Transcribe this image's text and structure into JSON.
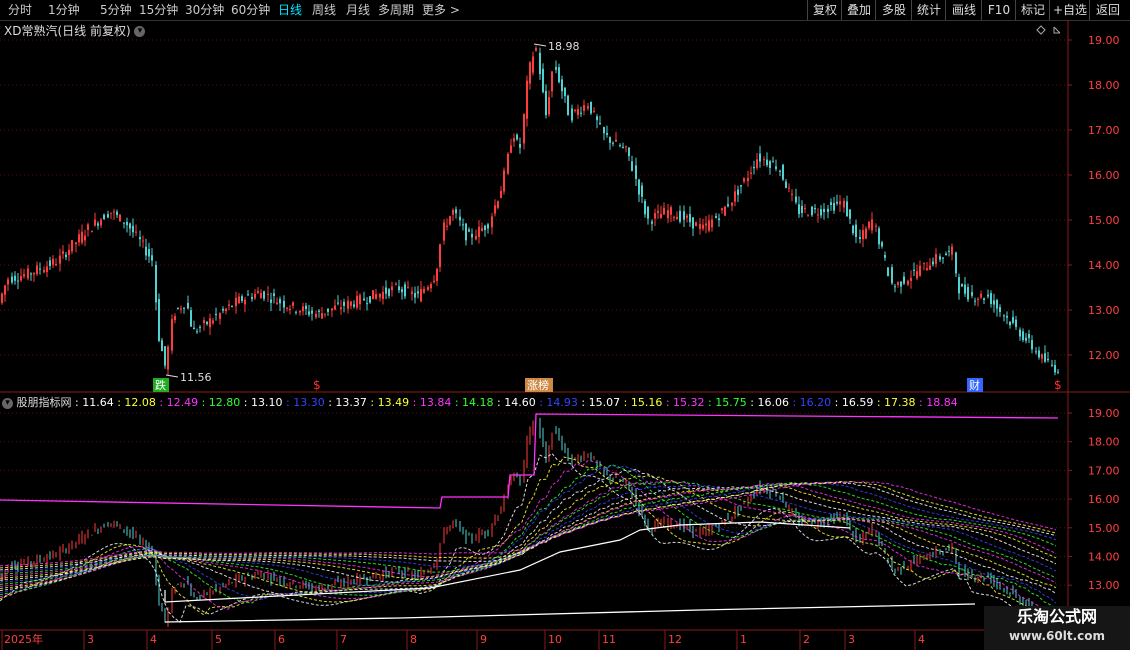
{
  "toolbar": {
    "timeframes": [
      "分时",
      "1分钟",
      "5分钟",
      "15分钟",
      "30分钟",
      "60分钟",
      "日线",
      "周线",
      "月线",
      "多周期",
      "更多 >"
    ],
    "active": "日线",
    "buttons": [
      "复权",
      "叠加",
      "多股",
      "统计",
      "画线",
      "F10",
      "标记",
      "+自选",
      "返回"
    ]
  },
  "main_chart": {
    "title": "XD常熟汽(日线 前复权)",
    "high_label": "18.98",
    "low_label": "11.56",
    "y_ticks": [
      "19.00",
      "18.00",
      "17.00",
      "16.00",
      "15.00",
      "14.00",
      "13.00",
      "12.00"
    ],
    "markers": [
      {
        "text": "跌",
        "color": "#22aa22"
      },
      {
        "text": "$",
        "color": "#ff3030"
      },
      {
        "text": "涨榜",
        "color": "#cc8844"
      },
      {
        "text": "财",
        "color": "#3366ff"
      },
      {
        "text": "$",
        "color": "#ff3030"
      }
    ],
    "colors": {
      "up": "#ff3c3c",
      "down": "#4fd2d2"
    }
  },
  "indicator": {
    "name": "股朋指标网",
    "values": [
      {
        "v": "11.64",
        "color": "#ffffff"
      },
      {
        "v": "12.08",
        "color": "#ffff33"
      },
      {
        "v": "12.49",
        "color": "#ff33ff"
      },
      {
        "v": "12.80",
        "color": "#33ff33"
      },
      {
        "v": "13.10",
        "color": "#ffffff"
      },
      {
        "v": "13.30",
        "color": "#3344ff"
      },
      {
        "v": "13.37",
        "color": "#ffffff"
      },
      {
        "v": "13.49",
        "color": "#ffff33"
      },
      {
        "v": "13.84",
        "color": "#ff33ff"
      },
      {
        "v": "14.18",
        "color": "#33ff33"
      },
      {
        "v": "14.60",
        "color": "#ffffff"
      },
      {
        "v": "14.93",
        "color": "#3344ff"
      },
      {
        "v": "15.07",
        "color": "#ffffff"
      },
      {
        "v": "15.16",
        "color": "#ffff33"
      },
      {
        "v": "15.32",
        "color": "#ff33ff"
      },
      {
        "v": "15.75",
        "color": "#33ff33"
      },
      {
        "v": "16.06",
        "color": "#ffffff"
      },
      {
        "v": "16.20",
        "color": "#3344ff"
      },
      {
        "v": "16.59",
        "color": "#ffffff"
      },
      {
        "v": "17.38",
        "color": "#ffff33"
      },
      {
        "v": "18.84",
        "color": "#ff33ff"
      }
    ],
    "y_ticks": [
      "19.00",
      "18.00",
      "17.00",
      "16.00",
      "15.00",
      "14.00",
      "13.00"
    ]
  },
  "x_axis": {
    "labels": [
      "2025年",
      "3",
      "4",
      "5",
      "6",
      "7",
      "8",
      "9",
      "10",
      "11",
      "12",
      "1",
      "2",
      "3",
      "4"
    ]
  },
  "watermark": {
    "line1": "乐淘公式网",
    "line2": "www.60lt.com"
  }
}
